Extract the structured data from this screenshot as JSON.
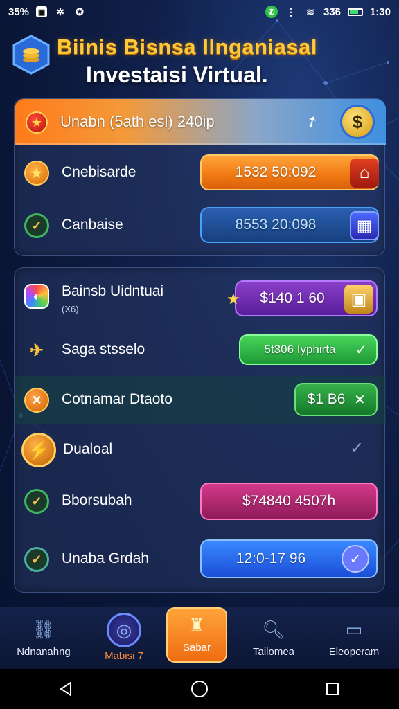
{
  "status_bar": {
    "left_text": "35%",
    "right_text": "33̈6 ",
    "time": "1:30",
    "icons": [
      "image-icon",
      "app-icon",
      "vpn-icon",
      "whatsapp-icon",
      "signal-icon",
      "wifi-icon",
      "battery-icon"
    ]
  },
  "header": {
    "title_top": "Biinis Bisnsa Ilnganiasal",
    "title_bottom": "Investaisi Virtual.",
    "logo_icon": "hexagon-coin-stack-icon"
  },
  "banner": {
    "text": "Unabn (5ath esl) 240ip",
    "star_icon": "star-icon",
    "arrow_icon": "arrow-icon",
    "coin_icon": "dollar-coin-icon"
  },
  "panel1": {
    "rows": [
      {
        "label": "Cnebisarde",
        "value": "1532 50:092",
        "icon": "star-icon",
        "deco": "house-icon"
      },
      {
        "label": "Canbaise",
        "value": "8553 20:098",
        "icon": "check-icon",
        "deco": "building-icon"
      }
    ]
  },
  "panel2": {
    "rows": [
      {
        "label": "Bainsb Uidntuai",
        "sub": "(X6)",
        "value": "$140 1 60",
        "icon": "palette-icon",
        "deco": "crate-icon"
      },
      {
        "label": "Saga stsselo",
        "value": "5t306 Iyphirta",
        "icon": "bird-icon",
        "action_icon": "check-icon"
      },
      {
        "label": "Cotnamar Dtaoto",
        "value": "$1 B6",
        "icon": "x-circle-icon",
        "action_icon": "x-icon"
      },
      {
        "label": "Dualoal",
        "icon": "plug-icon",
        "action_icon": "check-icon"
      },
      {
        "label": "Bborsubah",
        "value": "$74840  4507h",
        "icon": "check-icon"
      },
      {
        "label": "Unaba Grdah",
        "value": "12:0-17 96",
        "icon": "check-icon",
        "action_icon": "check-circle-icon"
      }
    ]
  },
  "bottom_nav": {
    "items": [
      {
        "label": "Ndnanahng",
        "icon": "chain-icon"
      },
      {
        "label": "Mabisi 7",
        "icon": "target-icon"
      },
      {
        "label": "Sabar",
        "icon": "castle-icon",
        "active": true
      },
      {
        "label": "Tailomea",
        "icon": "search-chart-icon"
      },
      {
        "label": "Eleoperam",
        "icon": "briefcase-icon"
      }
    ]
  },
  "colors": {
    "accent_gold": "#ffc93a",
    "orange": "#f07812",
    "blue": "#3a8aff",
    "green": "#48d45a",
    "pink": "#d43a8a",
    "purple": "#8a3ec8",
    "bg": "#0a1636"
  }
}
